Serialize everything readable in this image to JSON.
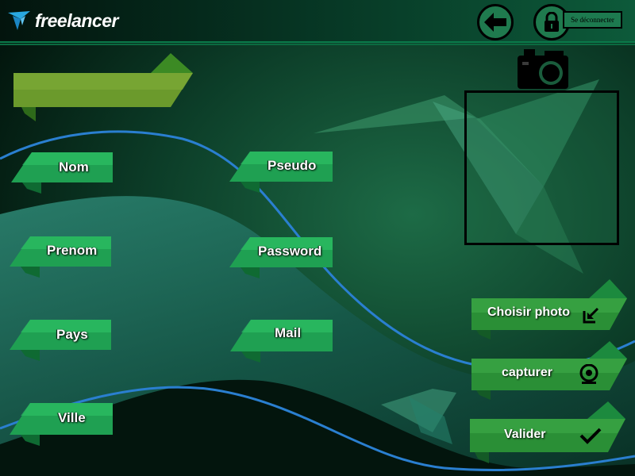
{
  "app": {
    "logo_text": "freelancer"
  },
  "header": {
    "logout_label": "Se déconnecter"
  },
  "form": {
    "nom_label": "Nom",
    "prenom_label": "Prenom",
    "pays_label": "Pays",
    "ville_label": "Ville",
    "pseudo_label": "Pseudo",
    "password_label": "Password",
    "mail_label": "Mail"
  },
  "actions": {
    "choose_photo_label": "Choisir photo",
    "capture_label": "capturer",
    "validate_label": "Valider"
  },
  "colors": {
    "ribbon_green": "#1fa052",
    "ribbon_olive": "#5e9a2a",
    "accent_blue": "#2a7fd0"
  },
  "icons": [
    "bird-logo-icon",
    "back-arrow-icon",
    "lock-icon",
    "camera-icon",
    "upload-icon",
    "webcam-icon",
    "checkmark-icon"
  ]
}
